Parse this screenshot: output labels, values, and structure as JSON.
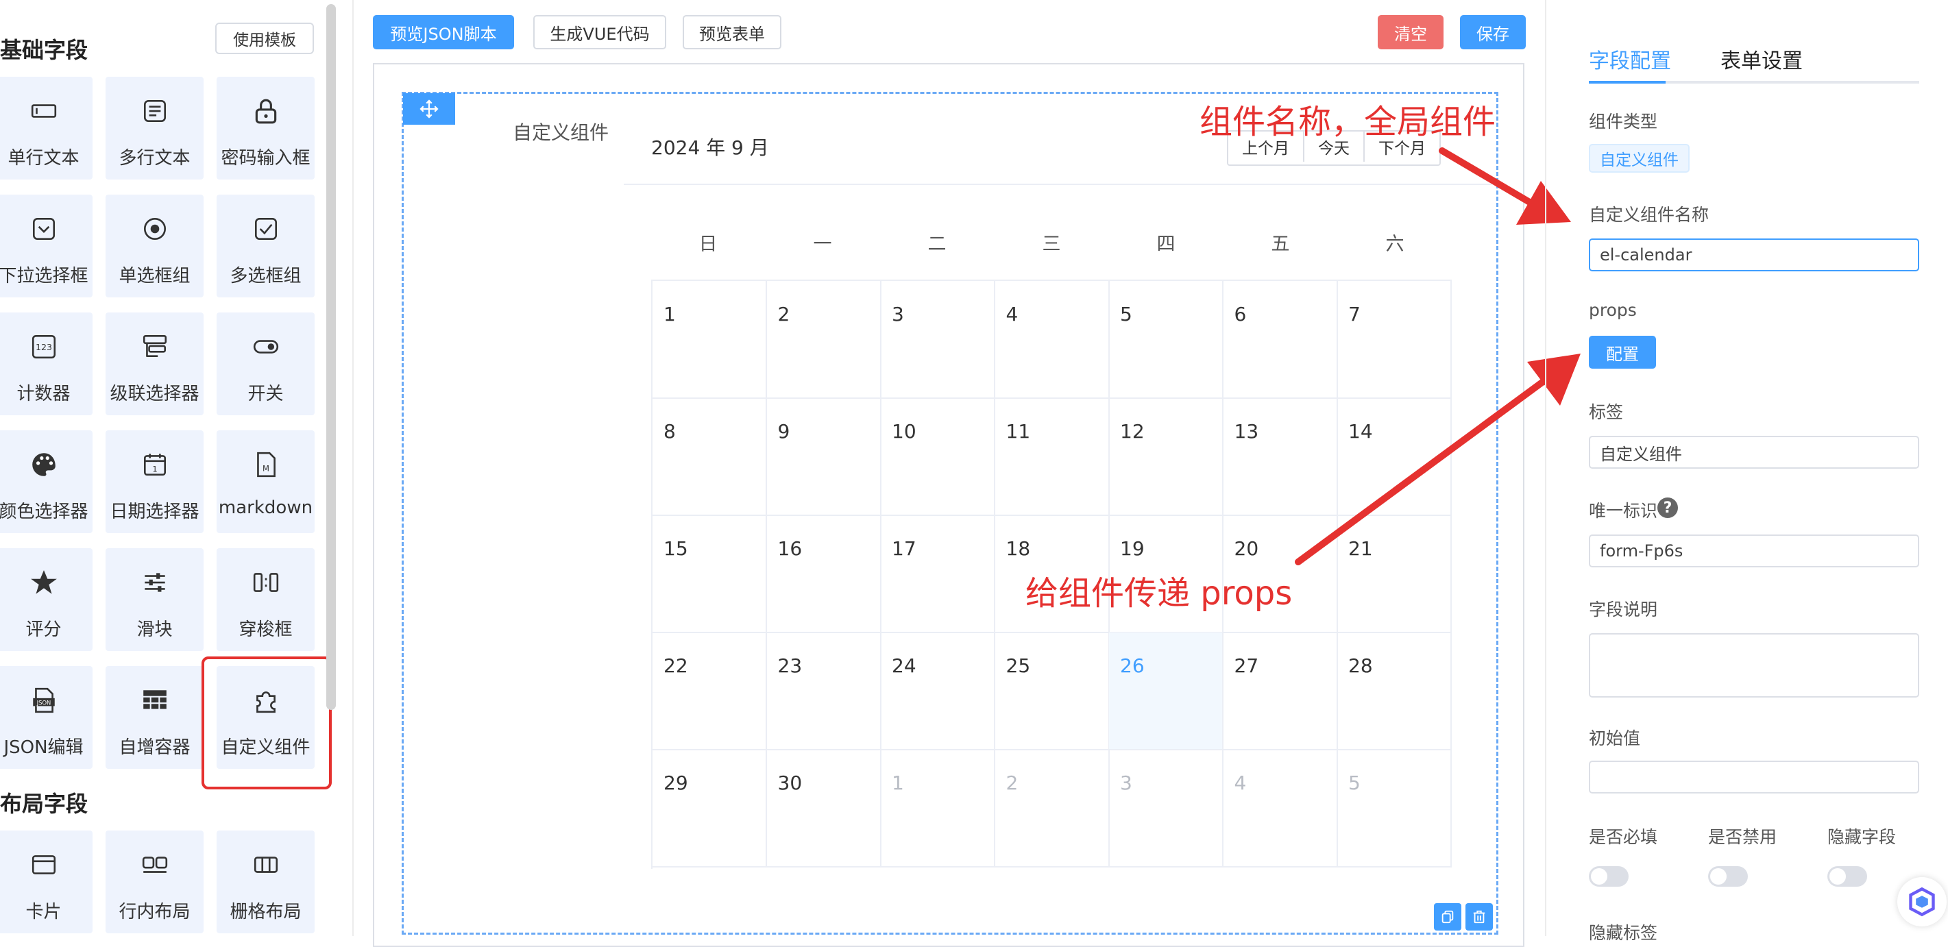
{
  "sidebar": {
    "basic_title": "基础字段",
    "template_button": "使用模板",
    "layout_title": "布局字段",
    "basic_items": [
      {
        "label": "单行文本",
        "icon": "input-icon"
      },
      {
        "label": "多行文本",
        "icon": "textarea-icon"
      },
      {
        "label": "密码输入框",
        "icon": "lock-icon"
      },
      {
        "label": "下拉选择框",
        "icon": "select-icon"
      },
      {
        "label": "单选框组",
        "icon": "radio-icon"
      },
      {
        "label": "多选框组",
        "icon": "checkbox-icon"
      },
      {
        "label": "计数器",
        "icon": "number-icon"
      },
      {
        "label": "级联选择器",
        "icon": "cascader-icon"
      },
      {
        "label": "开关",
        "icon": "switch-icon"
      },
      {
        "label": "颜色选择器",
        "icon": "palette-icon"
      },
      {
        "label": "日期选择器",
        "icon": "calendar-icon"
      },
      {
        "label": "markdown",
        "icon": "markdown-icon"
      },
      {
        "label": "评分",
        "icon": "star-icon"
      },
      {
        "label": "滑块",
        "icon": "slider-icon"
      },
      {
        "label": "穿梭框",
        "icon": "transfer-icon"
      },
      {
        "label": "JSON编辑",
        "icon": "json-icon"
      },
      {
        "label": "自增容器",
        "icon": "table-icon"
      },
      {
        "label": "自定义组件",
        "icon": "puzzle-icon"
      }
    ],
    "layout_items": [
      {
        "label": "卡片",
        "icon": "card-icon"
      },
      {
        "label": "行内布局",
        "icon": "inline-layout-icon"
      },
      {
        "label": "栅格布局",
        "icon": "grid-layout-icon"
      }
    ]
  },
  "toolbar": {
    "preview_json": "预览JSON脚本",
    "gen_vue": "生成VUE代码",
    "preview_form": "预览表单",
    "clear": "清空",
    "save": "保存"
  },
  "canvas": {
    "component_label": "自定义组件",
    "calendar": {
      "title": "2024 年 9 月",
      "prev": "上个月",
      "today": "今天",
      "next": "下个月",
      "weekdays": [
        "日",
        "一",
        "二",
        "三",
        "四",
        "五",
        "六"
      ],
      "days": [
        "1",
        "2",
        "3",
        "4",
        "5",
        "6",
        "7",
        "8",
        "9",
        "10",
        "11",
        "12",
        "13",
        "14",
        "15",
        "16",
        "17",
        "18",
        "19",
        "20",
        "21",
        "22",
        "23",
        "24",
        "25",
        "26",
        "27",
        "28",
        "29",
        "30",
        "1",
        "2",
        "3",
        "4",
        "5"
      ],
      "today_day": "26"
    }
  },
  "annotations": {
    "name_note": "组件名称，全局组件",
    "props_note": "给组件传递 props"
  },
  "panel": {
    "tab_field": "字段配置",
    "tab_form": "表单设置",
    "type_label": "组件类型",
    "type_value": "自定义组件",
    "name_label": "自定义组件名称",
    "name_value": "el-calendar",
    "props_label": "props",
    "config_button": "配置",
    "tag_label": "标签",
    "tag_value": "自定义组件",
    "id_label": "唯一标识",
    "id_value": "form-Fp6s",
    "desc_label": "字段说明",
    "init_label": "初始值",
    "required_label": "是否必填",
    "disabled_label": "是否禁用",
    "hidden_label": "隐藏字段",
    "hide_label_label": "隐藏标签"
  },
  "colors": {
    "primary": "#409eff",
    "danger": "#ef6f6c",
    "annotation": "#e5312f",
    "tile_bg": "#eef3fd"
  }
}
